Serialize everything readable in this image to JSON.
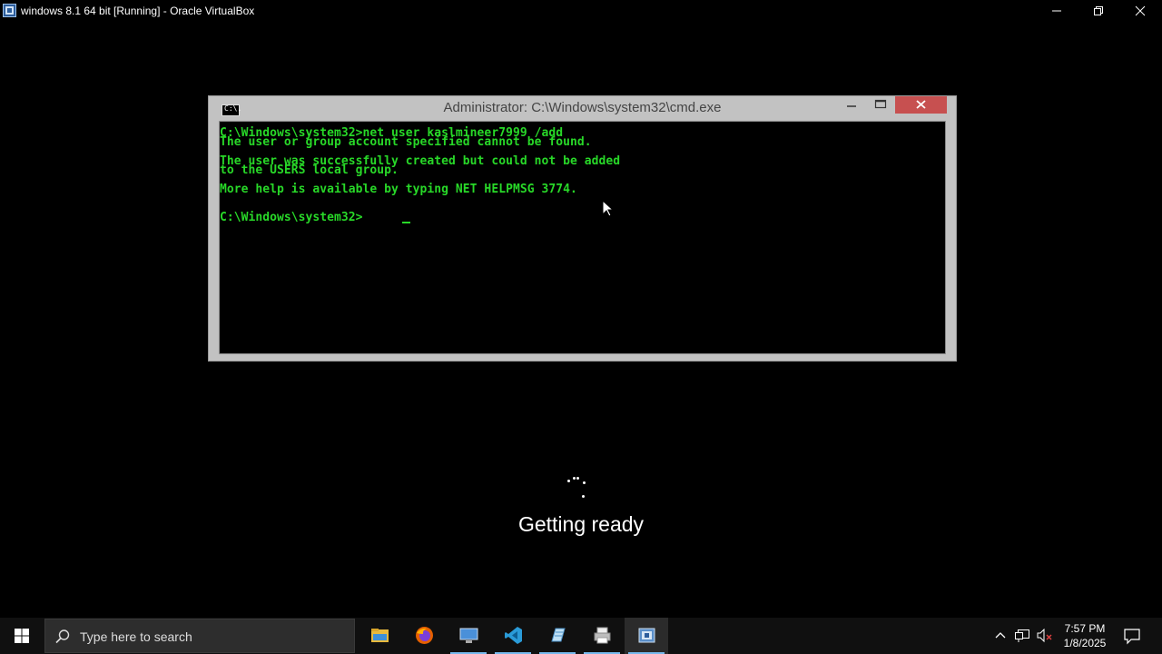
{
  "host_window": {
    "title": "windows 8.1 64 bit [Running] - Oracle VirtualBox",
    "icon": "virtualbox-icon"
  },
  "cmd_window": {
    "title": "Administrator: C:\\Windows\\system32\\cmd.exe",
    "icon": "cmd-icon",
    "icon_glyph": "C:\\.",
    "output": "C:\\Windows\\system32>net user kaslmineer7999 /add\nThe user or group account specified cannot be found.\n\nThe user was successfully created but could not be added\nto the USERS local group.\n\nMore help is available by typing NET HELPMSG 3774.\n\n\nC:\\Windows\\system32>"
  },
  "boot_screen": {
    "status_text": "Getting ready"
  },
  "taskbar": {
    "search_placeholder": "Type here to search",
    "apps": [
      {
        "name": "file-explorer",
        "icon": "folder-icon"
      },
      {
        "name": "firefox",
        "icon": "firefox-icon"
      },
      {
        "name": "remote-desktop",
        "icon": "remote-desktop-icon"
      },
      {
        "name": "visual-studio-code",
        "icon": "vscode-icon"
      },
      {
        "name": "notepad-app",
        "icon": "notepad-icon"
      },
      {
        "name": "printer-app",
        "icon": "printer-icon"
      },
      {
        "name": "virtualbox",
        "icon": "virtualbox-icon",
        "active": true
      }
    ],
    "clock": {
      "time": "7:57 PM",
      "date": "1/8/2025"
    }
  },
  "colors": {
    "console_text": "#28d828",
    "cmd_close": "#c75050",
    "accent": "#76b9ed"
  }
}
